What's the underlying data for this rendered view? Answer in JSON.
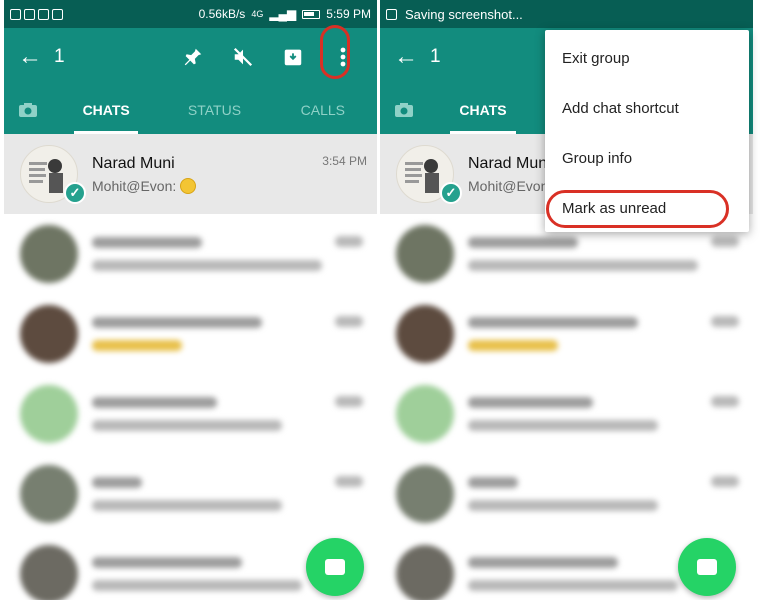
{
  "left": {
    "statusbar": {
      "speed": "0.56kB/s",
      "network": "4G",
      "time": "5:59 PM"
    },
    "appbar": {
      "back_icon": "arrow-left-icon",
      "selected_count": "1",
      "actions": [
        "pin-icon",
        "mute-icon",
        "archive-icon",
        "more-vert-icon"
      ]
    },
    "tabs": {
      "camera_icon": "camera-icon",
      "chats": "CHATS",
      "status": "STATUS",
      "calls": "CALLS"
    },
    "chat": {
      "name": "Narad Muni",
      "message": "Mohit@Evon:",
      "time": "3:54 PM"
    }
  },
  "right": {
    "statusbar": {
      "notice": "Saving screenshot..."
    },
    "appbar": {
      "back_icon": "arrow-left-icon",
      "selected_count": "1"
    },
    "tabs": {
      "chats": "CHATS"
    },
    "chat": {
      "name": "Narad Muni",
      "message": "Mohit@Evon:"
    },
    "menu": {
      "items": [
        "Exit group",
        "Add chat shortcut",
        "Group info",
        "Mark as unread"
      ],
      "highlighted": "Mark as unread"
    }
  },
  "colors": {
    "status_bar": "#075e54",
    "app_bar": "#128c7e",
    "fab": "#25d366",
    "highlight": "#d93025"
  }
}
